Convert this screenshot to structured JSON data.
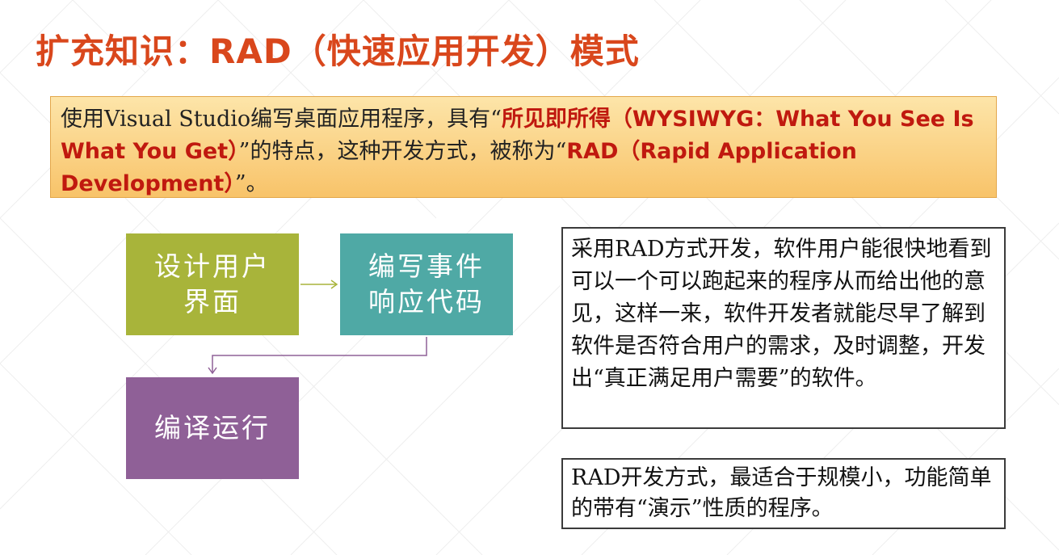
{
  "title": "扩充知识：RAD（快速应用开发）模式",
  "intro": {
    "part1": "使用Visual Studio编写桌面应用程序，具有“",
    "highlight1": "所见即所得（WYSIWYG：What You See Is What You Get）",
    "part2": "”的特点，这种开发方式，被称为“",
    "highlight2": "RAD（Rapid Application Development）",
    "part3": "”。"
  },
  "flow": {
    "box1": [
      "设计用户",
      "界面"
    ],
    "box2": [
      "编写事件",
      "响应代码"
    ],
    "box3": "编译运行"
  },
  "note1": "采用RAD方式开发，软件用户能很快地看到可以一个可以跑起来的程序从而给出他的意见，这样一来，软件开发者就能尽早了解到软件是否符合用户的需求，及时调整，开发出“真正满足用户需要”的软件。",
  "note2": "RAD开发方式，最适合于规模小，功能简单的带有“演示”性质的程序。",
  "colors": {
    "title": "#d9471c",
    "highlight": "#c0190f",
    "box1": "#a8b43a",
    "box2": "#4fa9a5",
    "box3": "#8f6097"
  }
}
